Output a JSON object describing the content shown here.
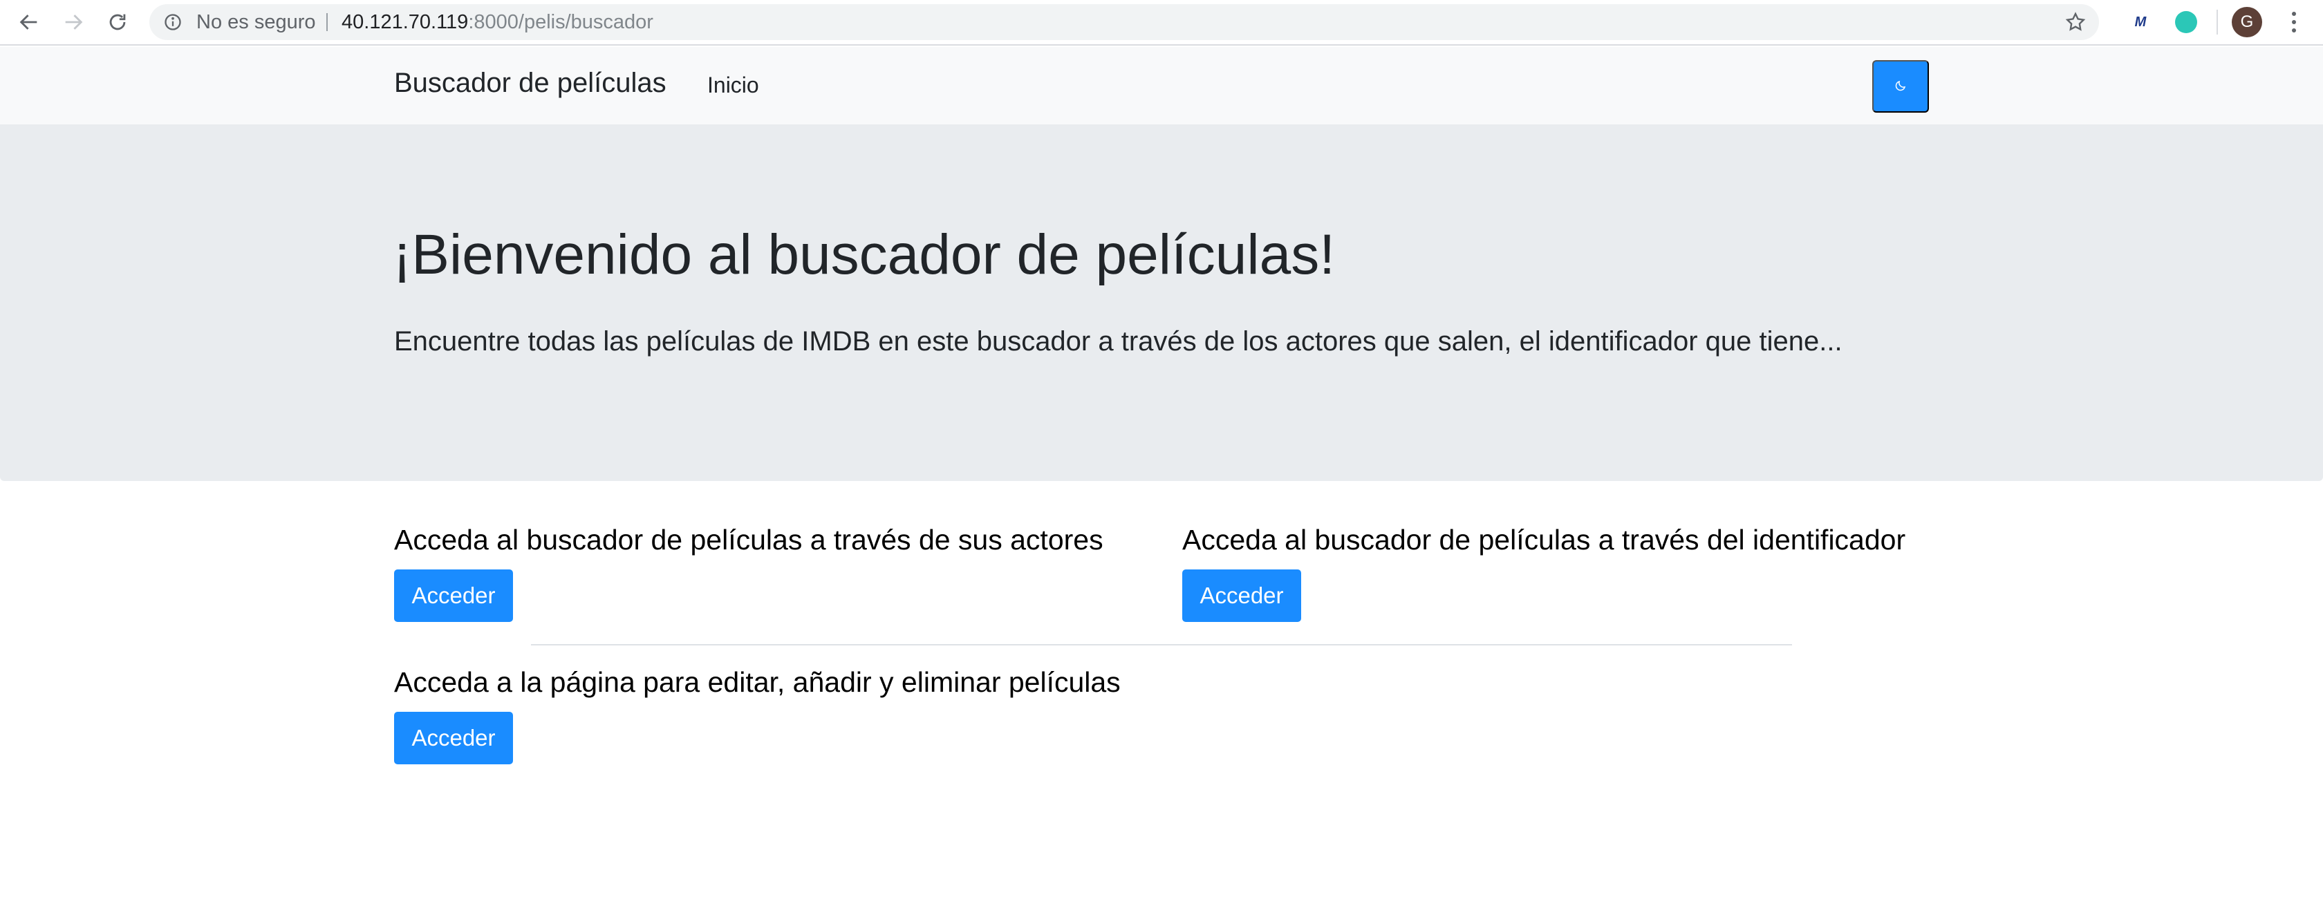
{
  "browser": {
    "security_label": "No es seguro",
    "url_host": "40.121.70.119",
    "url_rest": ":8000/pelis/buscador",
    "profile_initial": "G",
    "extension_label": "M"
  },
  "navbar": {
    "brand": "Buscador de películas",
    "links": [
      {
        "label": "Inicio"
      }
    ],
    "dark_toggle_icon": "moon-icon"
  },
  "jumbotron": {
    "title": "¡Bienvenido al buscador de películas!",
    "lead": "Encuentre todas las películas de IMDB en este buscador a través de los actores que salen, el identificador que tiene..."
  },
  "sections": [
    {
      "heading": "Acceda al buscador de películas a través de sus actores",
      "button_label": "Acceder"
    },
    {
      "heading": "Acceda al buscador de películas a través del identificador",
      "button_label": "Acceder"
    },
    {
      "heading": "Acceda a la página para editar, añadir y eliminar películas",
      "button_label": "Acceder"
    }
  ],
  "colors": {
    "primary": "#1a8cff",
    "navbar_bg": "#f8f9fa",
    "jumbotron_bg": "#e9ecef"
  }
}
